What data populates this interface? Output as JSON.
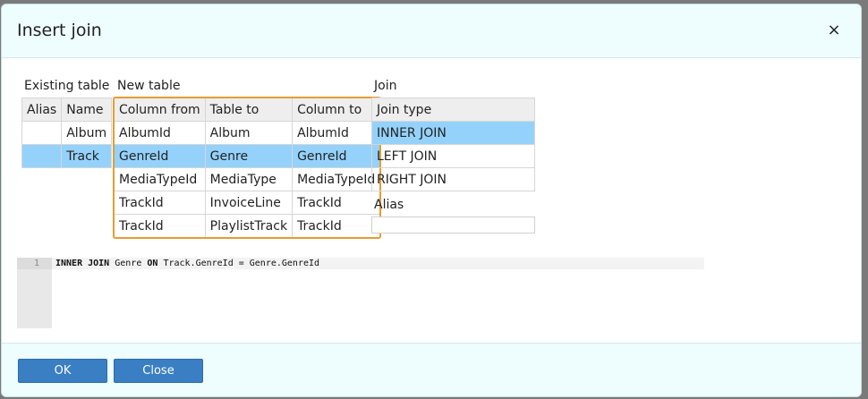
{
  "dialog": {
    "title": "Insert join",
    "close_label": "×"
  },
  "existing_table": {
    "label": "Existing table",
    "headers": [
      "Alias",
      "Name"
    ],
    "rows": [
      {
        "alias": "",
        "name": "Album",
        "selected": false
      },
      {
        "alias": "",
        "name": "Track",
        "selected": true
      }
    ]
  },
  "new_table": {
    "label": "New table",
    "headers": [
      "Column from",
      "Table to",
      "Column to"
    ],
    "rows": [
      {
        "from": "AlbumId",
        "table": "Album",
        "to": "AlbumId",
        "selected": false
      },
      {
        "from": "GenreId",
        "table": "Genre",
        "to": "GenreId",
        "selected": true
      },
      {
        "from": "MediaTypeId",
        "table": "MediaType",
        "to": "MediaTypeId",
        "selected": false
      },
      {
        "from": "TrackId",
        "table": "InvoiceLine",
        "to": "TrackId",
        "selected": false
      },
      {
        "from": "TrackId",
        "table": "PlaylistTrack",
        "to": "TrackId",
        "selected": false
      }
    ]
  },
  "join": {
    "label": "Join",
    "header": "Join type",
    "types": [
      {
        "label": "INNER JOIN",
        "selected": true
      },
      {
        "label": "LEFT JOIN",
        "selected": false
      },
      {
        "label": "RIGHT JOIN",
        "selected": false
      }
    ],
    "alias_label": "Alias",
    "alias_value": ""
  },
  "editor": {
    "line_number": "1",
    "kw1": "INNER JOIN",
    "t1": " Genre ",
    "kw2": "ON",
    "t2": " Track.GenreId = Genre.GenreId"
  },
  "footer": {
    "ok_label": "OK",
    "close_label": "Close"
  },
  "colors": {
    "header_bg": "#eefdfd",
    "selection": "#95d2fb",
    "focus_border": "#e79c31",
    "button": "#3a7fc3"
  }
}
